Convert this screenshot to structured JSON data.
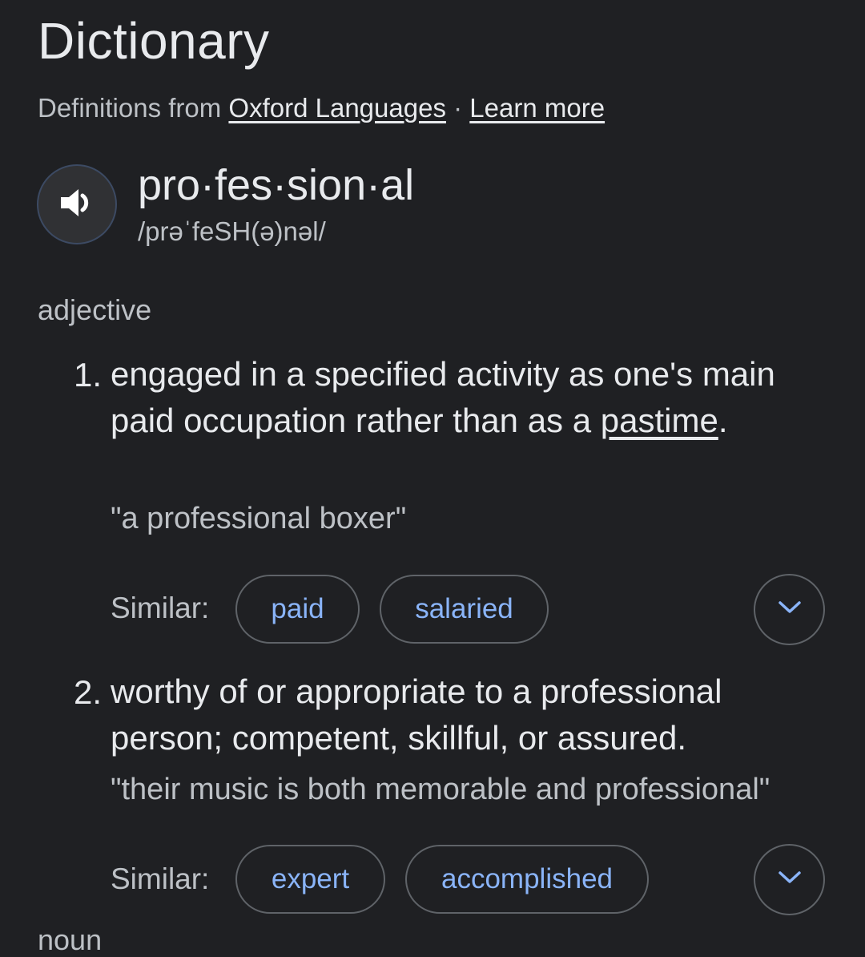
{
  "header": {
    "title": "Dictionary",
    "source_prefix": "Definitions from",
    "source_link": "Oxford Languages",
    "separator": "·",
    "learn_more": "Learn more"
  },
  "entry": {
    "speaker_icon": "speaker-icon",
    "headword": "pro·fes·sion·al",
    "phonetic": "/prəˈfeSH(ə)nəl/",
    "part_of_speech": "adjective",
    "next_part_of_speech": "noun"
  },
  "senses": [
    {
      "number": "1.",
      "text_before": "engaged in a specified activity as one's main paid occupation rather than as a ",
      "link": "pastime",
      "text_after": ".",
      "example": "\"a professional boxer\"",
      "similar_label": "Similar:",
      "similar": [
        "paid",
        "salaried"
      ]
    },
    {
      "number": "2.",
      "text": "worthy of or appropriate to a professional person; competent, skillful, or assured.",
      "example": "\"their music is both memorable and professional\"",
      "similar_label": "Similar:",
      "similar": [
        "expert",
        "accomplished"
      ]
    }
  ],
  "colors": {
    "background": "#1f2023",
    "text": "#e8eaed",
    "muted": "#bdc1c6",
    "chip_text": "#8ab4f8",
    "chip_border": "#5f6368"
  }
}
